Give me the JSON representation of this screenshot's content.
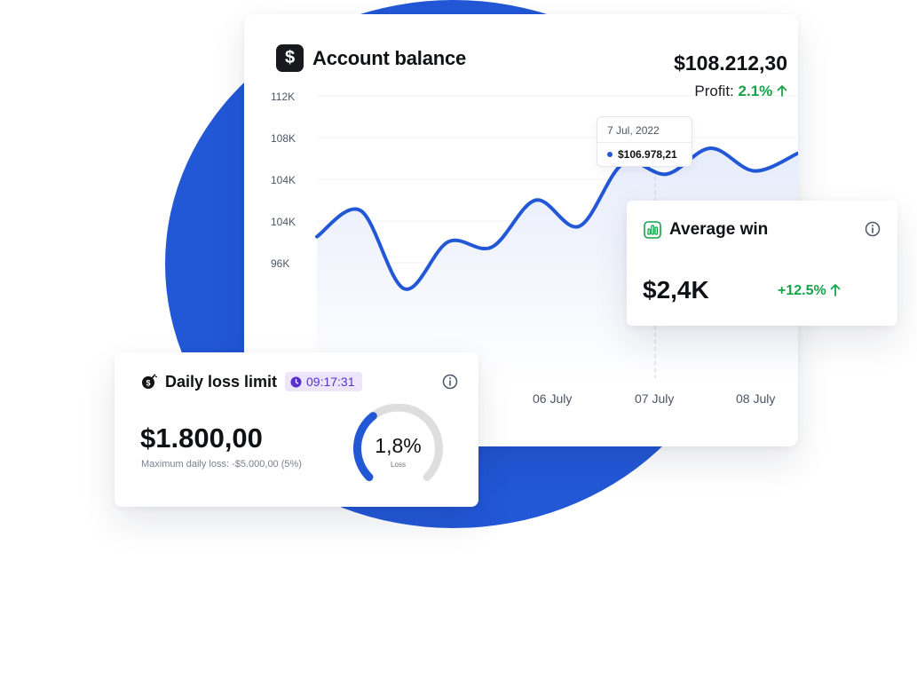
{
  "balance_card": {
    "title": "Account balance",
    "total": "$108.212,30",
    "profit_label": "Profit:",
    "profit_pct": "2.1%",
    "tooltip": {
      "date": "7 Jul, 2022",
      "value": "$106.978,21"
    }
  },
  "chart_data": {
    "type": "area",
    "title": "Account balance",
    "y_tick_labels": [
      "112K",
      "108K",
      "104K",
      "104K",
      "96K"
    ],
    "x_tick_labels": [
      "06 July",
      "07 July",
      "08 July"
    ],
    "series": [
      {
        "values": [
          98.5,
          101.0,
          93.5,
          98.0,
          97.5,
          102.0,
          99.5,
          105.5,
          104.5,
          106.98,
          104.8,
          106.5
        ]
      }
    ],
    "highlight": {
      "x": "07 July",
      "value": 106978.21
    },
    "colors": {
      "line": "#2257d6",
      "fill_top": "#e7ecfb",
      "fill_bottom": "#ffffff"
    },
    "grid": true
  },
  "avg_win": {
    "label": "Average win",
    "value": "$2,4K",
    "change": "+12.5%"
  },
  "daily_loss": {
    "label": "Daily loss limit",
    "timer": "09:17:31",
    "value": "$1.800,00",
    "sub": "Maximum daily loss: -$5.000,00 (5%)",
    "gauge_value": "1,8%",
    "gauge_label": "Loss",
    "gauge_fraction": 0.36
  },
  "colors": {
    "accent": "#2257d6",
    "positive": "#16a34a",
    "timer_bg": "#ede6fb",
    "timer_text": "#5b2fc9"
  }
}
